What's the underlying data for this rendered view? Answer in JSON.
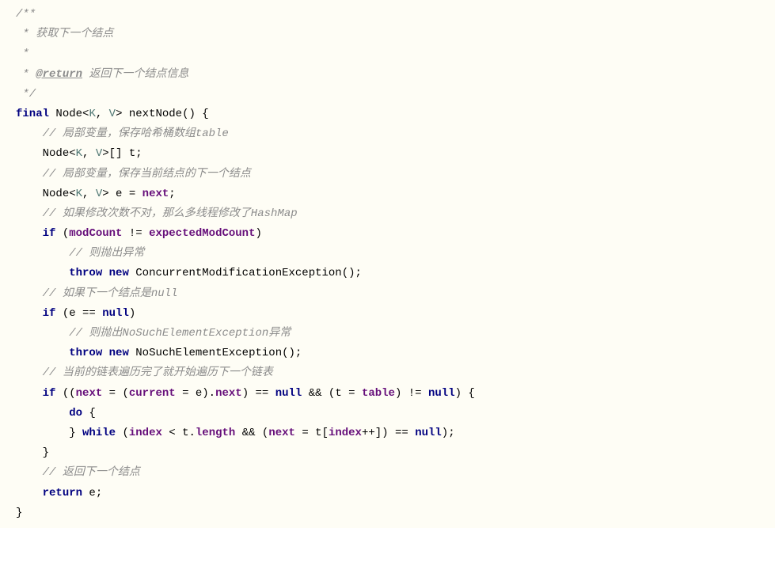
{
  "code": {
    "l1": "/**",
    "l2_prefix": " * ",
    "l2_text": "获取下一个结点",
    "l3": " *",
    "l4_prefix": " * ",
    "l4_tag": "@return",
    "l4_text": " 返回下一个结点信息",
    "l5": " */",
    "l6_kw_final": "final",
    "l6_type": " Node",
    "l6_gen_open": "<",
    "l6_gen_k": "K",
    "l6_gen_sep": ", ",
    "l6_gen_v": "V",
    "l6_gen_close": ">",
    "l6_method": " nextNode() {",
    "l7_comment": "// 局部变量，保存哈希桶数组table",
    "l8_type": "Node",
    "l8_gen_open": "<",
    "l8_gen_k": "K",
    "l8_gen_sep": ", ",
    "l8_gen_v": "V",
    "l8_gen_close": ">",
    "l8_rest": "[] t;",
    "l9_comment": "// 局部变量，保存当前结点的下一个结点",
    "l10_type": "Node",
    "l10_gen_open": "<",
    "l10_gen_k": "K",
    "l10_gen_sep": ", ",
    "l10_gen_v": "V",
    "l10_gen_close": ">",
    "l10_mid": " e = ",
    "l10_next": "next",
    "l10_end": ";",
    "l11_comment": "// 如果修改次数不对，那么多线程修改了HashMap",
    "l12_if": "if",
    "l12_open": " (",
    "l12_mod": "modCount",
    "l12_ne": " != ",
    "l12_exp": "expectedModCount",
    "l12_close": ")",
    "l13_comment": "// 则抛出异常",
    "l14_throw": "throw",
    "l14_sp": " ",
    "l14_new": "new",
    "l14_exc": " ConcurrentModificationException();",
    "l15_comment": "// 如果下一个结点是null",
    "l16_if": "if",
    "l16_open": " (e == ",
    "l16_null": "null",
    "l16_close": ")",
    "l17_comment": "// 则抛出NoSuchElementException异常",
    "l18_throw": "throw",
    "l18_sp": " ",
    "l18_new": "new",
    "l18_exc": " NoSuchElementException();",
    "l19_comment": "// 当前的链表遍历完了就开始遍历下一个链表",
    "l20_if": "if",
    "l20_a": " ((",
    "l20_next": "next",
    "l20_b": " = (",
    "l20_current": "current",
    "l20_c": " = e).",
    "l20_next2": "next",
    "l20_d": ") == ",
    "l20_null1": "null",
    "l20_e": " && (t = ",
    "l20_table": "table",
    "l20_f": ") != ",
    "l20_null2": "null",
    "l20_g": ") {",
    "l21_do": "do",
    "l21_brace": " {",
    "l22_brace": "} ",
    "l22_while": "while",
    "l22_a": " (",
    "l22_index": "index",
    "l22_b": " < t.",
    "l22_length": "length",
    "l22_c": " && (",
    "l22_next": "next",
    "l22_d": " = t[",
    "l22_index2": "index",
    "l22_e": "++]) == ",
    "l22_null": "null",
    "l22_f": ");",
    "l23_brace": "}",
    "l24_comment": "// 返回下一个结点",
    "l25_return": "return",
    "l25_rest": " e;",
    "l26_brace": "}"
  }
}
